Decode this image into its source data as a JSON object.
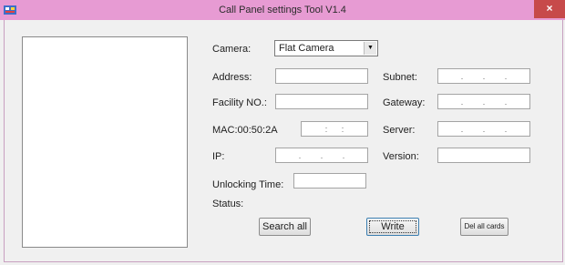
{
  "window": {
    "title": "Call Panel settings Tool V1.4",
    "close_label": "×",
    "titlebar_color": "#e79bd3",
    "close_color": "#c74a4a"
  },
  "form": {
    "camera_label": "Camera:",
    "camera_value": "Flat Camera",
    "address_label": "Address:",
    "address_value": "",
    "facility_label": "Facility NO.:",
    "facility_value": "",
    "mac_label": "MAC:00:50:2A",
    "mac_separator": ":",
    "ip_label": "IP:",
    "unlock_label": "Unlocking  Time:",
    "unlock_value": "",
    "status_label": "Status:",
    "subnet_label": "Subnet:",
    "gateway_label": "Gateway:",
    "server_label": "Server:",
    "version_label": "Version:",
    "version_value": "",
    "ip_dot": "."
  },
  "buttons": {
    "search_all": "Search all",
    "write": "Write",
    "del_all_cards": "Del all cards"
  }
}
